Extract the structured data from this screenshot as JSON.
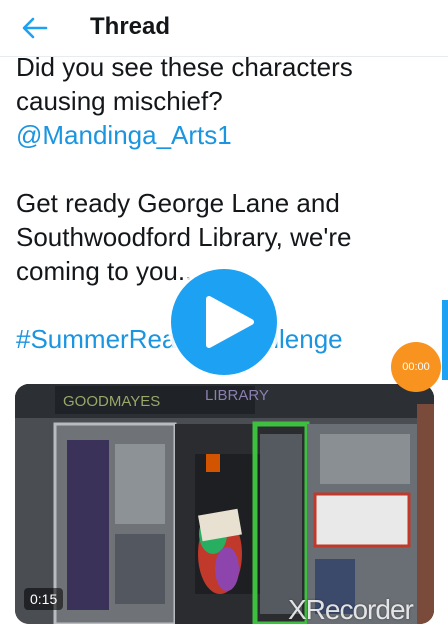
{
  "header": {
    "title": "Thread",
    "back_icon": "arrow-left-icon"
  },
  "tweet": {
    "line1": "Did you see these characters",
    "line2": "causing mischief?",
    "mention": "@Mandinga_Arts1",
    "para2_line1": "Get ready George Lane and",
    "para2_line2": "Southwoodford Library, we're",
    "para2_line3": "coming to you...",
    "hashtag": "#SummerReadingChallenge"
  },
  "media": {
    "duration": "0:15",
    "sign_left": "GOODMAYES",
    "sign_right": "LIBRARY",
    "play_icon": "play-icon"
  },
  "overlay": {
    "timer": "00:00",
    "watermark": "XRecorder"
  },
  "colors": {
    "link": "#1b95e0",
    "play": "#1da1f2",
    "timer": "#f7931e"
  }
}
